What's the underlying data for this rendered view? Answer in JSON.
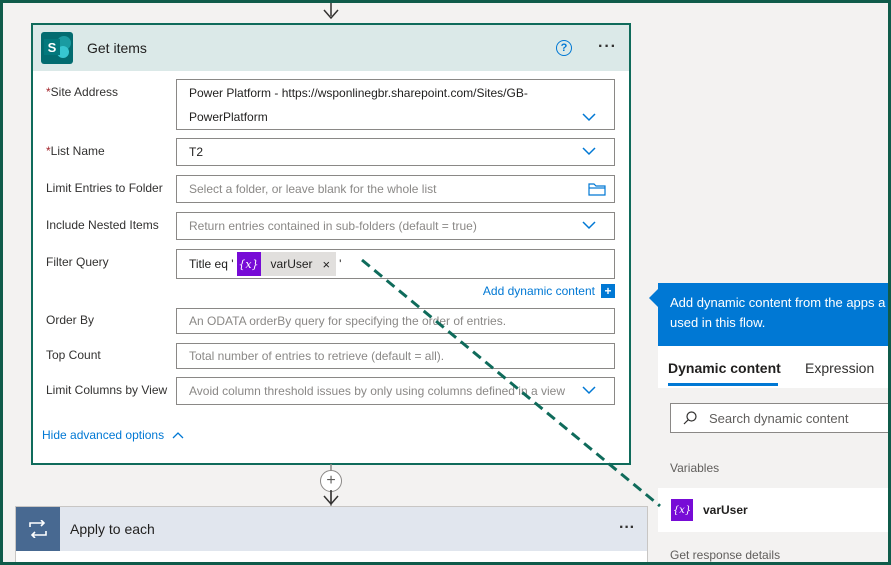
{
  "get_items": {
    "title": "Get items",
    "help_glyph": "?",
    "more_glyph": "···",
    "fields": {
      "site_address": {
        "label": "Site Address",
        "required_mark": "*",
        "value_line1": "Power Platform - https://wsponlinegbr.sharepoint.com/Sites/GB-",
        "value_line2": "PowerPlatform"
      },
      "list_name": {
        "label": "List Name",
        "required_mark": "*",
        "value": "T2"
      },
      "limit_entries": {
        "label": "Limit Entries to Folder",
        "placeholder": "Select a folder, or leave blank for the whole list"
      },
      "include_nested": {
        "label": "Include Nested Items",
        "placeholder": "Return entries contained in sub-folders (default = true)"
      },
      "filter_query": {
        "label": "Filter Query",
        "prefix": "Title eq '",
        "token_icon": "{x}",
        "token_label": "varUser",
        "token_remove": "×",
        "suffix": "'"
      },
      "order_by": {
        "label": "Order By",
        "placeholder": "An ODATA orderBy query for specifying the order of entries."
      },
      "top_count": {
        "label": "Top Count",
        "placeholder": "Total number of entries to retrieve (default = all)."
      },
      "limit_columns": {
        "label": "Limit Columns by View",
        "placeholder": "Avoid column threshold issues by only using columns defined in a view"
      }
    },
    "add_dynamic_content": "Add dynamic content",
    "add_dynamic_plus": "+",
    "hide_advanced": "Hide advanced options"
  },
  "connector_plus": "+",
  "apply_to_each": {
    "title": "Apply to each",
    "more_glyph": "···"
  },
  "dynamic_panel": {
    "header_line1": "Add dynamic content from the apps a",
    "header_line2": "used in this flow.",
    "tabs": [
      "Dynamic content",
      "Expression"
    ],
    "search_placeholder": "Search dynamic content",
    "section_variables": "Variables",
    "variable_icon": "{x}",
    "variable_name": "varUser",
    "section_response": "Get response details"
  },
  "colors": {
    "accent": "#0078d4",
    "card_border": "#0f6b5b",
    "variable_purple": "#770bd6",
    "frame": "#0f5b4a"
  }
}
